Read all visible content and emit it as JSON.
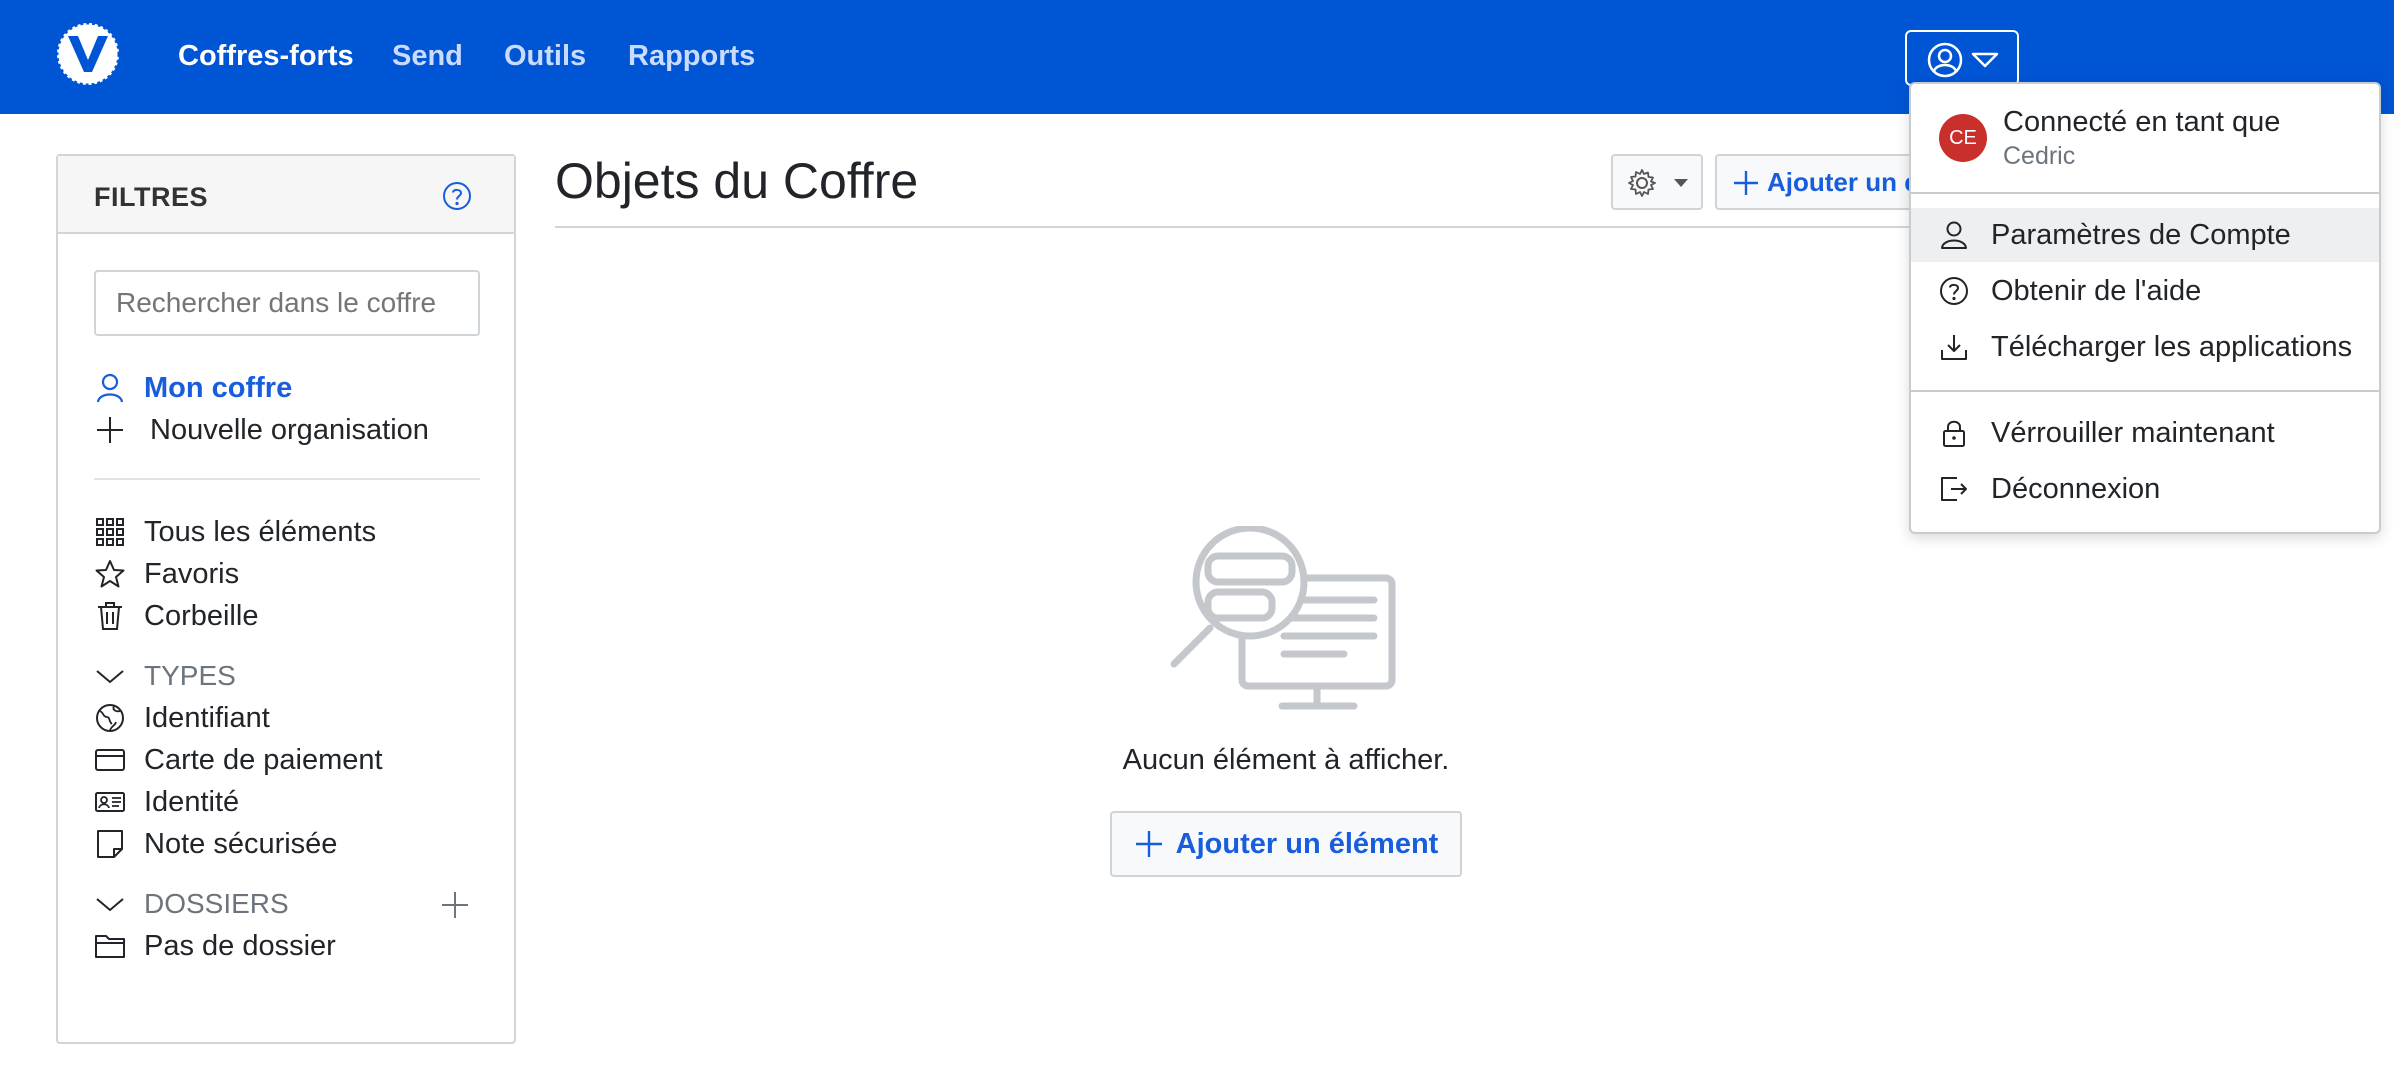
{
  "nav": {
    "links": [
      "Coffres-forts",
      "Send",
      "Outils",
      "Rapports"
    ]
  },
  "sidebar": {
    "title": "FILTRES",
    "search_placeholder": "Rechercher dans le coffre",
    "my_vault": "Mon coffre",
    "new_org": "Nouvelle organisation",
    "all_items": "Tous les éléments",
    "favorites": "Favoris",
    "trash": "Corbeille",
    "types_header": "TYPES",
    "types": [
      "Identifiant",
      "Carte de paiement",
      "Identité",
      "Note sécurisée"
    ],
    "folders_header": "DOSSIERS",
    "no_folder": "Pas de dossier"
  },
  "main": {
    "title": "Objets du Coffre",
    "add_top_label": "Ajouter un élément",
    "empty_text": "Aucun élément à afficher.",
    "add_label": "Ajouter un élément"
  },
  "dropdown": {
    "avatar_initials": "CE",
    "logged_in_as": "Connecté en tant que",
    "user_name": "Cedric",
    "items": [
      "Paramètres de Compte",
      "Obtenir de l'aide",
      "Télécharger les applications"
    ],
    "items2": [
      "Vérrouiller maintenant",
      "Déconnexion"
    ]
  },
  "colors": {
    "brand": "#0055d4",
    "link": "#175ddc",
    "avatar": "#c9302c"
  }
}
